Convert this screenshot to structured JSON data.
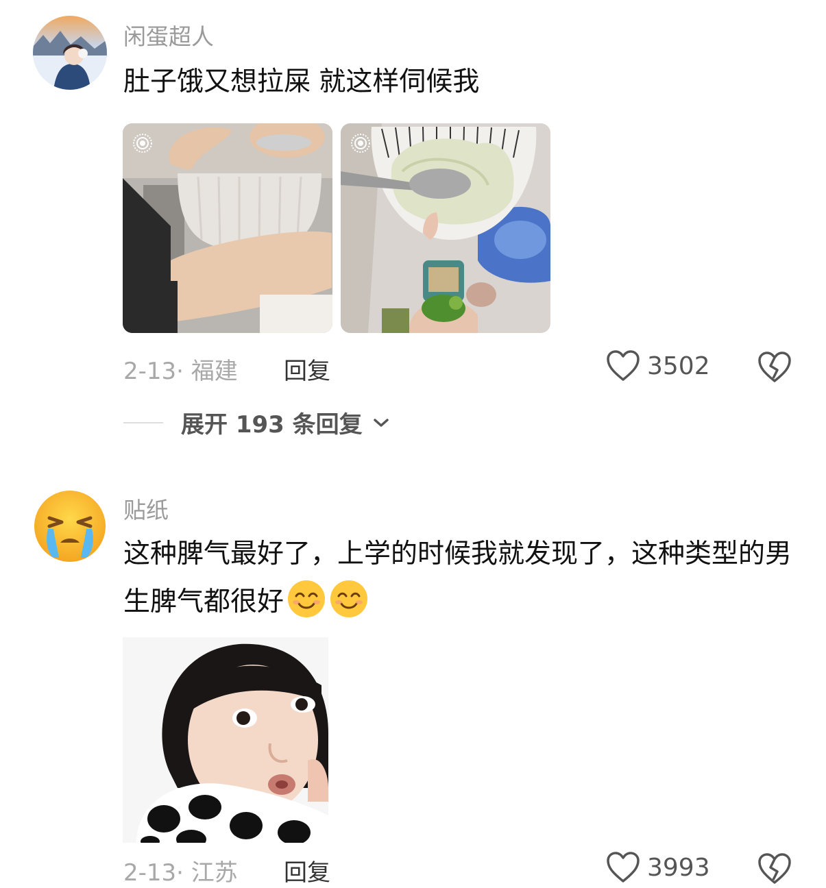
{
  "comments": [
    {
      "username": "闲蛋超人",
      "text": "肚子饿又想拉屎 就这样伺候我",
      "date_location": "2-13· 福建",
      "reply_label": "回复",
      "likes": "3502",
      "expand_label": "展开 193 条回复"
    },
    {
      "username": "贴纸",
      "text": "这种脾气最好了，上学的时候我就发现了，这种类型的男生脾气都很好",
      "date_location": "2-13· 江苏",
      "reply_label": "回复",
      "likes": "3993"
    }
  ],
  "icons": [
    "live-photo-icon",
    "heart-outline-icon",
    "heart-broken-icon",
    "chevron-down-icon",
    "smile-emoji-icon",
    "crying-emoji-icon"
  ],
  "colors": {
    "text": "#111111",
    "muted": "#9a9a9a",
    "icon": "#555555"
  }
}
